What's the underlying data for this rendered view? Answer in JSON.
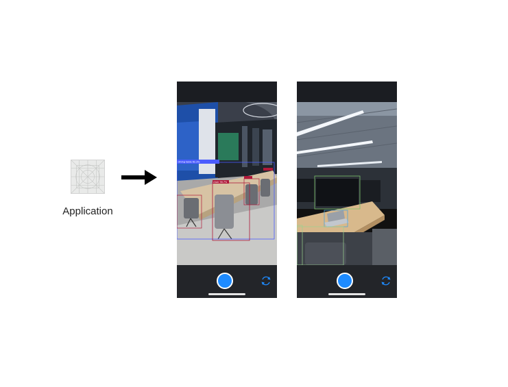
{
  "app": {
    "label": "Application",
    "icon": "app-placeholder-icon"
  },
  "arrow": {
    "icon": "right-arrow-icon",
    "color": "#000000"
  },
  "screens": [
    {
      "name": "office-detection-view",
      "shutter_color": "#1e8bff",
      "detections": [
        {
          "label": "dining table 62.3%",
          "color": "#4a5cff"
        },
        {
          "label": "chair 56.7%",
          "color": "#b0193a"
        },
        {
          "label": "",
          "color": "#b0193a"
        },
        {
          "label": "",
          "color": "#b0193a"
        }
      ]
    },
    {
      "name": "workstation-detection-view",
      "shutter_color": "#1e8bff",
      "detections": [
        {
          "label": "",
          "color": "#7cc46a"
        },
        {
          "label": "",
          "color": "#4fa3d9"
        },
        {
          "label": "",
          "color": "#9ad38f"
        }
      ]
    }
  ],
  "colors": {
    "accent": "#1e8bff",
    "toolbar": "#232529"
  }
}
